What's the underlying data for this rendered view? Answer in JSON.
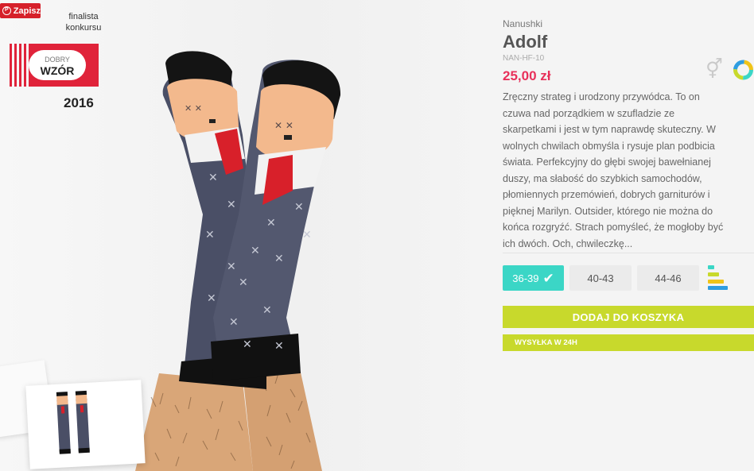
{
  "pin": {
    "label": "Zapisz",
    "icon": "pinterest-icon"
  },
  "award": {
    "caption_line1": "finalista",
    "caption_line2": "konkursu",
    "logo_line1": "DOBRY",
    "logo_line2": "WZÓR",
    "year": "2016"
  },
  "product": {
    "brand": "Nanushki",
    "title": "Adolf",
    "sku": "NAN-HF-10",
    "price": "25,00 zł",
    "description_lines": [
      "Zręczny strateg i urodzony przywódca. To on",
      "czuwa nad porządkiem w szufladzie ze",
      "skarpetkami i jest w tym naprawdę skuteczny. W",
      "wolnych chwilach obmyśla i rysuje plan podbicia",
      "świata. Perfekcyjny do głębi swojej bawełnianej",
      "duszy, ma słabość do szybkich samochodów,",
      "płomiennych przemówień, dobrych garniturów i",
      "pięknej Marilyn. Outsider, którego nie można do",
      "końca rozgryźć. Strach pomyśleć, że mogłoby być",
      "ich dwóch. Och, chwileczkę..."
    ],
    "sizes": [
      {
        "label": "36-39",
        "selected": true
      },
      {
        "label": "40-43",
        "selected": false
      },
      {
        "label": "44-46",
        "selected": false
      }
    ],
    "add_to_cart": "DODAJ DO KOSZYKA",
    "shipping": "WYSYŁKA W 24H"
  },
  "colors": {
    "accent_red": "#e8305a",
    "size_selected": "#3bd6c6",
    "cta_green": "#c8d92c"
  },
  "icons": [
    "pinterest-icon",
    "unisex-gender-icon",
    "color-ring-icon",
    "check-icon",
    "size-guide-icon"
  ]
}
